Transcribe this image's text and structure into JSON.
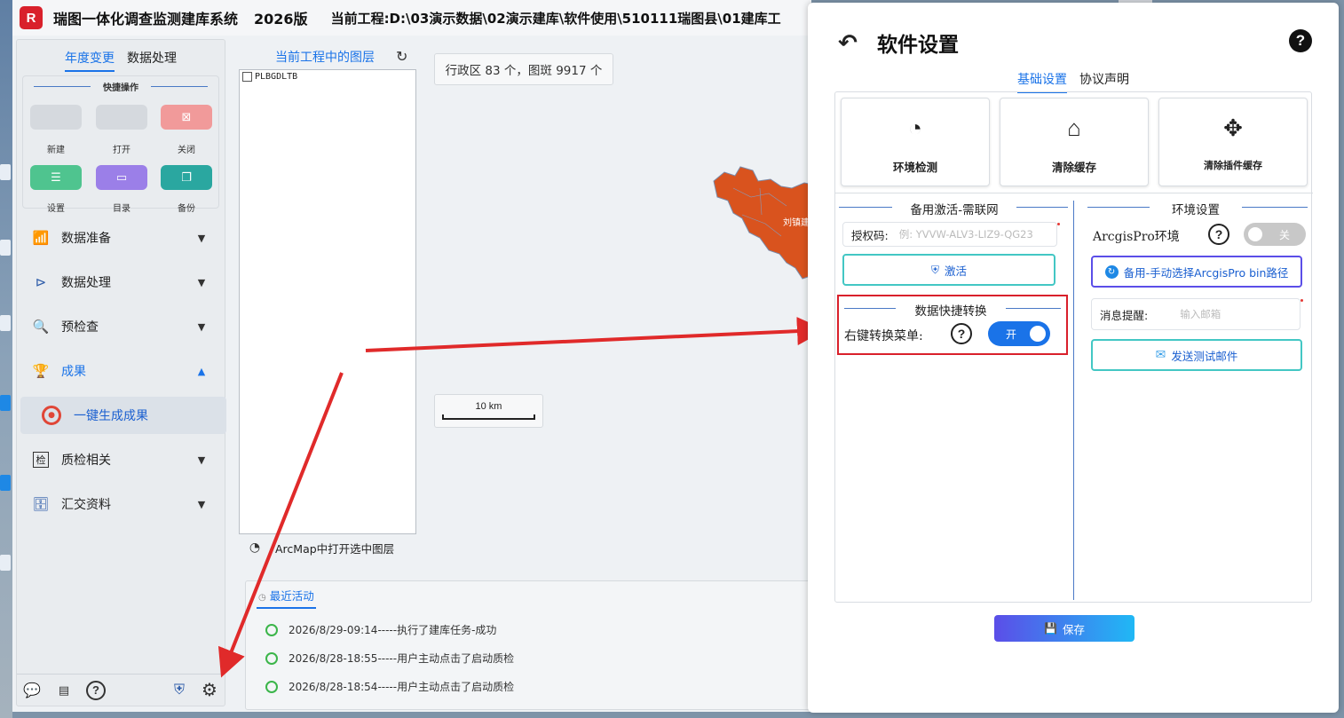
{
  "app": {
    "logo_text": "R",
    "title": "瑞图一体化调查监测建库系统",
    "version": "2026版",
    "project_path": "当前工程:D:\\03演示数据\\02演示建库\\软件使用\\510111瑞图县\\01建库工"
  },
  "left_panel": {
    "tabs": [
      "年度变更",
      "数据处理"
    ],
    "quick_title": "快捷操作",
    "quick_actions": [
      {
        "label": "新建",
        "icon": "new-icon",
        "color": "#d5d9de"
      },
      {
        "label": "打开",
        "icon": "open-icon",
        "color": "#d5d9de"
      },
      {
        "label": "关闭",
        "icon": "close-icon",
        "color": "#f19a9a"
      },
      {
        "label": "设置",
        "icon": "settings-icon",
        "color": "#4fc48f"
      },
      {
        "label": "目录",
        "icon": "folder-icon",
        "color": "#9b7fe8"
      },
      {
        "label": "备份",
        "icon": "backup-icon",
        "color": "#2aa7a0"
      }
    ],
    "nav": [
      {
        "label": "数据准备",
        "icon": "chart-icon"
      },
      {
        "label": "数据处理",
        "icon": "process-icon"
      },
      {
        "label": "预检查",
        "icon": "precheck-icon"
      },
      {
        "label": "成果",
        "icon": "trophy-icon"
      },
      {
        "label": "质检相关",
        "icon": "qc-icon"
      },
      {
        "label": "汇交资料",
        "icon": "archive-icon"
      }
    ],
    "sub_item": "一键生成成果",
    "qc_glyph": "检"
  },
  "layers": {
    "tab": "当前工程中的图层",
    "items": [
      "PLBGDLTB"
    ],
    "arcmap_label": "ArcMap中打开选中图层"
  },
  "map": {
    "stats": "行政区 83 个，图斑 9917 个",
    "place_label": "刘镇建店",
    "scale_label": "10 km"
  },
  "recent": {
    "tab": "最近活动",
    "items": [
      "2026/8/29-09:14-----执行了建库任务-成功",
      "2026/8/28-18:55-----用户主动点击了启动质检",
      "2026/8/28-18:54-----用户主动点击了启动质检"
    ]
  },
  "dialog": {
    "title": "软件设置",
    "help": "?",
    "tabs": [
      "基础设置",
      "协议声明"
    ],
    "cards": [
      "环境检测",
      "清除缓存",
      "清除插件缓存"
    ],
    "left_section": "备用激活-需联网",
    "auth_label": "授权码:",
    "auth_placeholder": "例: YVVW-ALV3-LIZ9-QG23",
    "activate_label": "激活",
    "quick_section": "数据快捷转换",
    "context_menu_label": "右键转换菜单:",
    "context_menu_state": "开",
    "right_section": "环境设置",
    "arcgispro_label": "ArcgisPro环境",
    "arcgispro_state": "关",
    "arcgispro_btn": "备用-手动选择ArcgisPro bin路径",
    "mail_label": "消息提醒:",
    "mail_placeholder": "输入邮箱",
    "mail_btn": "发送测试邮件",
    "save_label": "保存"
  },
  "colors": {
    "accent": "#1a73e8",
    "highlight_red": "#d9202b",
    "success_green": "#3bb54a",
    "map_fill": "#d9531e"
  }
}
